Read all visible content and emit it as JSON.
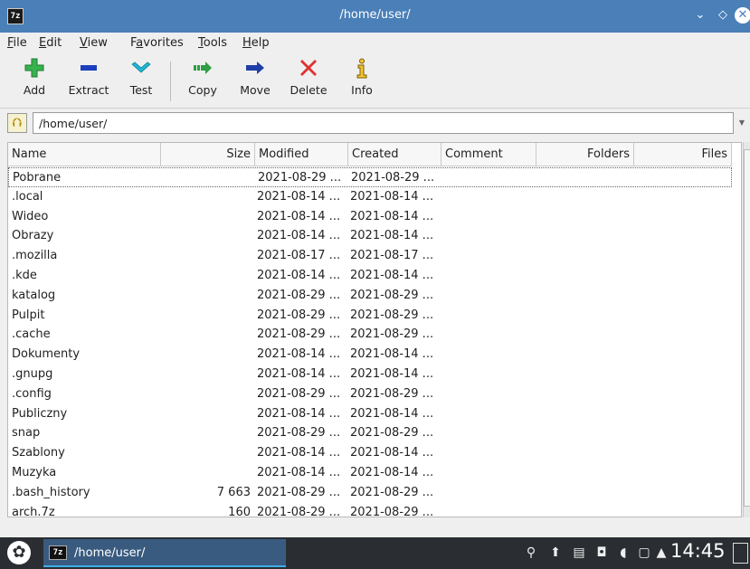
{
  "window": {
    "title": "/home/user/",
    "app_icon_text": "7z",
    "min_glyph": "⌄",
    "max_glyph": "◇",
    "close_glyph": "✕"
  },
  "menu": {
    "items": [
      {
        "ul": "F",
        "rest": "ile"
      },
      {
        "ul": "E",
        "rest": "dit"
      },
      {
        "ul": "V",
        "rest": "iew"
      },
      {
        "pre": "F",
        "ul": "a",
        "rest": "vorites"
      },
      {
        "ul": "T",
        "rest": "ools"
      },
      {
        "ul": "H",
        "rest": "elp"
      }
    ]
  },
  "toolbar": {
    "add": "Add",
    "extract": "Extract",
    "test": "Test",
    "copy": "Copy",
    "move": "Move",
    "delete": "Delete",
    "info": "Info"
  },
  "address": {
    "value": "/home/user/"
  },
  "columns": {
    "name": "Name",
    "size": "Size",
    "modified": "Modified",
    "created": "Created",
    "comment": "Comment",
    "folders": "Folders",
    "files": "Files"
  },
  "rows": [
    {
      "name": "Pobrane",
      "size": "",
      "modified": "2021-08-29 ...",
      "created": "2021-08-29 ..."
    },
    {
      "name": ".local",
      "size": "",
      "modified": "2021-08-14 ...",
      "created": "2021-08-14 ..."
    },
    {
      "name": "Wideo",
      "size": "",
      "modified": "2021-08-14 ...",
      "created": "2021-08-14 ..."
    },
    {
      "name": "Obrazy",
      "size": "",
      "modified": "2021-08-14 ...",
      "created": "2021-08-14 ..."
    },
    {
      "name": ".mozilla",
      "size": "",
      "modified": "2021-08-17 ...",
      "created": "2021-08-17 ..."
    },
    {
      "name": ".kde",
      "size": "",
      "modified": "2021-08-14 ...",
      "created": "2021-08-14 ..."
    },
    {
      "name": "katalog",
      "size": "",
      "modified": "2021-08-29 ...",
      "created": "2021-08-29 ..."
    },
    {
      "name": "Pulpit",
      "size": "",
      "modified": "2021-08-29 ...",
      "created": "2021-08-29 ..."
    },
    {
      "name": ".cache",
      "size": "",
      "modified": "2021-08-29 ...",
      "created": "2021-08-29 ..."
    },
    {
      "name": "Dokumenty",
      "size": "",
      "modified": "2021-08-14 ...",
      "created": "2021-08-14 ..."
    },
    {
      "name": ".gnupg",
      "size": "",
      "modified": "2021-08-14 ...",
      "created": "2021-08-14 ..."
    },
    {
      "name": ".config",
      "size": "",
      "modified": "2021-08-29 ...",
      "created": "2021-08-29 ..."
    },
    {
      "name": "Publiczny",
      "size": "",
      "modified": "2021-08-14 ...",
      "created": "2021-08-14 ..."
    },
    {
      "name": "snap",
      "size": "",
      "modified": "2021-08-29 ...",
      "created": "2021-08-29 ..."
    },
    {
      "name": "Szablony",
      "size": "",
      "modified": "2021-08-14 ...",
      "created": "2021-08-14 ..."
    },
    {
      "name": "Muzyka",
      "size": "",
      "modified": "2021-08-14 ...",
      "created": "2021-08-14 ..."
    },
    {
      "name": ".bash_history",
      "size": "7 663",
      "modified": "2021-08-29 ...",
      "created": "2021-08-29 ..."
    },
    {
      "name": "arch.7z",
      "size": "160",
      "modified": "2021-08-29 ...",
      "created": "2021-08-29 ..."
    }
  ],
  "taskbar": {
    "task_icon_text": "7z",
    "task_label": "/home/user/",
    "clock": "14:45"
  },
  "colors": {
    "titlebar": "#4a7fb8",
    "taskbar": "#2a2e32",
    "add_green": "#37b24d",
    "extract_blue": "#1c3fbf",
    "test_cyan": "#1fb6d4",
    "copy_green": "#2f9e44",
    "move_navy": "#1f3fa8",
    "delete_red": "#e03131"
  }
}
